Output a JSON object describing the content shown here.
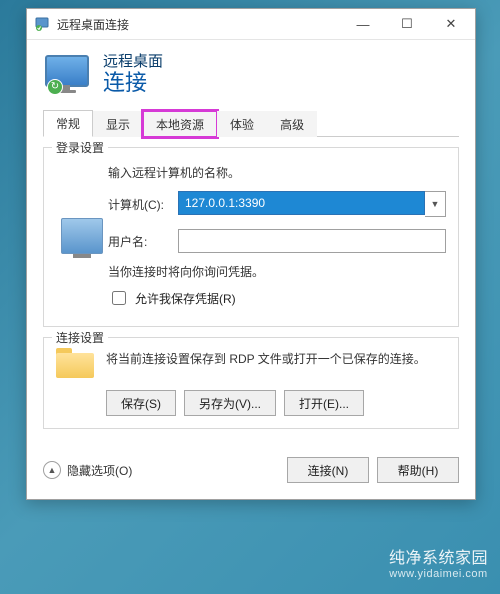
{
  "window": {
    "title": "远程桌面连接",
    "header_line1": "远程桌面",
    "header_line2": "连接"
  },
  "tabs": [
    "常规",
    "显示",
    "本地资源",
    "体验",
    "高级"
  ],
  "active_tab_index": 0,
  "highlighted_tab_index": 2,
  "login_group": {
    "legend": "登录设置",
    "prompt": "输入远程计算机的名称。",
    "computer_label": "计算机(C):",
    "computer_value": "127.0.0.1:3390",
    "user_label": "用户名:",
    "user_value": "",
    "note": "当你连接时将向你询问凭据。",
    "save_creds_label": "允许我保存凭据(R)"
  },
  "conn_group": {
    "legend": "连接设置",
    "text": "将当前连接设置保存到 RDP 文件或打开一个已保存的连接。",
    "save": "保存(S)",
    "save_as": "另存为(V)...",
    "open": "打开(E)..."
  },
  "footer": {
    "collapse": "隐藏选项(O)",
    "connect": "连接(N)",
    "help": "帮助(H)"
  },
  "watermark": {
    "main": "纯净系统家园",
    "sub": "www.yidaimei.com"
  }
}
